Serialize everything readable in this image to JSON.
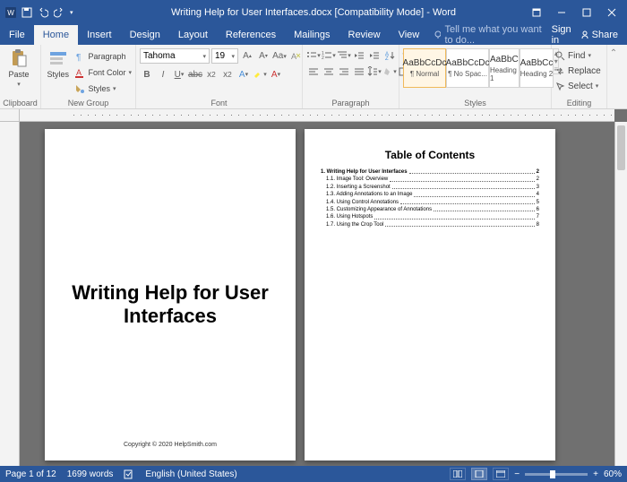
{
  "titlebar": {
    "title": "Writing Help for User Interfaces.docx [Compatibility Mode] - Word"
  },
  "menutabs": {
    "file": "File",
    "home": "Home",
    "insert": "Insert",
    "design": "Design",
    "layout": "Layout",
    "references": "References",
    "mailings": "Mailings",
    "review": "Review",
    "view": "View",
    "tell": "Tell me what you want to do...",
    "signin": "Sign in",
    "share": "Share"
  },
  "ribbon": {
    "clipboard": {
      "label": "Clipboard",
      "paste": "Paste"
    },
    "newgroup": {
      "label": "New Group",
      "styles": "Styles",
      "paragraph": "Paragraph",
      "fontcolor": "Font Color",
      "styles2": "Styles"
    },
    "font": {
      "label": "Font",
      "name": "Tahoma",
      "size": "19"
    },
    "paragraph": {
      "label": "Paragraph"
    },
    "styles": {
      "label": "Styles",
      "items": [
        {
          "preview": "AaBbCcDc",
          "name": "¶ Normal"
        },
        {
          "preview": "AaBbCcDc",
          "name": "¶ No Spac..."
        },
        {
          "preview": "AaBbC",
          "name": "Heading 1"
        },
        {
          "preview": "AaBbCc",
          "name": "Heading 2"
        }
      ]
    },
    "editing": {
      "label": "Editing",
      "find": "Find",
      "replace": "Replace",
      "select": "Select"
    }
  },
  "doc": {
    "page1_title": "Writing Help for User Interfaces",
    "page1_copyright": "Copyright © 2020 HelpSmith.com",
    "page2_toc_title": "Table of Contents",
    "toc": [
      {
        "level": 1,
        "label": "1. Writing Help for User Interfaces",
        "page": "2"
      },
      {
        "level": 2,
        "label": "1.1. Image Tool: Overview",
        "page": "2"
      },
      {
        "level": 2,
        "label": "1.2. Inserting a Screenshot",
        "page": "3"
      },
      {
        "level": 2,
        "label": "1.3. Adding Annotations to an Image",
        "page": "4"
      },
      {
        "level": 2,
        "label": "1.4. Using Control Annotations",
        "page": "5"
      },
      {
        "level": 2,
        "label": "1.5. Customizing Appearance of Annotations",
        "page": "6"
      },
      {
        "level": 2,
        "label": "1.6. Using Hotspots",
        "page": "7"
      },
      {
        "level": 2,
        "label": "1.7. Using the Crop Tool",
        "page": "8"
      }
    ]
  },
  "statusbar": {
    "page": "Page 1 of 12",
    "words": "1699 words",
    "lang": "English (United States)",
    "zoom": "60%"
  }
}
